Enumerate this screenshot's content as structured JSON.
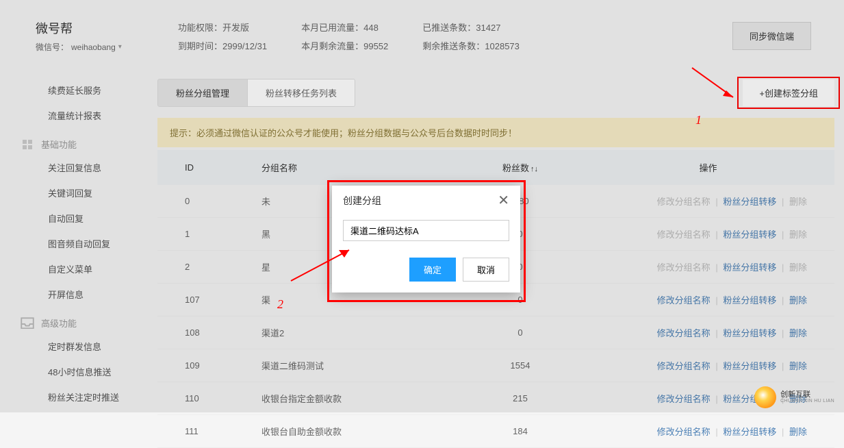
{
  "header": {
    "app_title": "微号帮",
    "wechat_label": "微信号：",
    "wechat_id": "weihaobang",
    "stats": {
      "perm_label": "功能权限：",
      "perm_value": "开发版",
      "expire_label": "到期时间：",
      "expire_value": "2999/12/31",
      "used_label": "本月已用流量：",
      "used_value": "448",
      "remain_label": "本月剩余流量：",
      "remain_value": "99552",
      "pushed_label": "已推送条数：",
      "pushed_value": "31427",
      "push_remain_label": "剩余推送条数：",
      "push_remain_value": "1028573"
    },
    "sync_btn": "同步微信端"
  },
  "sidebar": {
    "items_top": [
      "续费延长服务",
      "流量统计报表"
    ],
    "section_basic": "基础功能",
    "items_basic": [
      "关注回复信息",
      "关键词回复",
      "自动回复",
      "图音频自动回复",
      "自定义菜单",
      "开屏信息"
    ],
    "section_advanced": "高级功能",
    "items_advanced": [
      "定时群发信息",
      "48小时信息推送",
      "粉丝关注定时推送"
    ]
  },
  "tabs": {
    "manage": "粉丝分组管理",
    "transfer": "粉丝转移任务列表",
    "create_btn": "+创建标签分组"
  },
  "tip": "提示：必须通过微信认证的公众号才能使用；粉丝分组数据与公众号后台数据时时同步！",
  "table": {
    "headers": {
      "id": "ID",
      "name": "分组名称",
      "count": "粉丝数",
      "ops": "操作"
    },
    "ops_labels": {
      "edit": "修改分组名称",
      "transfer": "粉丝分组转移",
      "delete": "删除"
    },
    "rows": [
      {
        "id": "0",
        "name": "未",
        "count": "3 80",
        "editable": false
      },
      {
        "id": "1",
        "name": "黑",
        "count": "0",
        "editable": false
      },
      {
        "id": "2",
        "name": "星",
        "count": "0",
        "editable": false
      },
      {
        "id": "107",
        "name": "渠",
        "count": "0",
        "editable": true
      },
      {
        "id": "108",
        "name": "渠道2",
        "count": "0",
        "editable": true
      },
      {
        "id": "109",
        "name": "渠道二维码测试",
        "count": "1554",
        "editable": true
      },
      {
        "id": "110",
        "name": "收银台指定金额收款",
        "count": "215",
        "editable": true
      },
      {
        "id": "111",
        "name": "收银台自助金额收款",
        "count": "184",
        "editable": true
      }
    ]
  },
  "modal": {
    "title": "创建分组",
    "input_value": "渠道二维码达标A",
    "ok": "确定",
    "cancel": "取消"
  },
  "annotations": {
    "a1": "1",
    "a2": "2"
  },
  "watermark": {
    "cn": "创新互联",
    "en": "CHUANG XIN HU LIAN"
  }
}
